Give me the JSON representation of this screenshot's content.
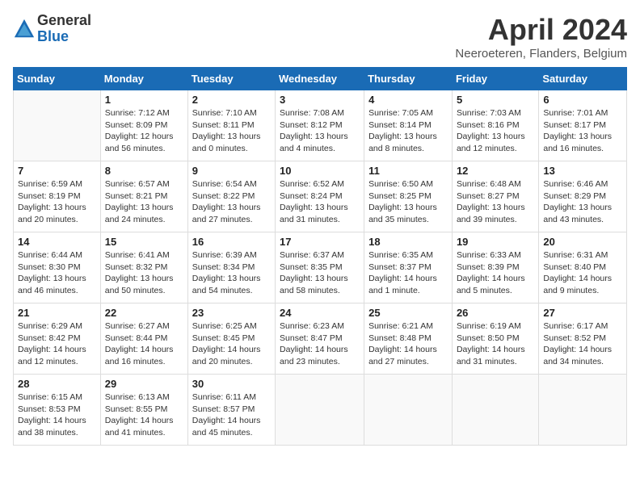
{
  "logo": {
    "general": "General",
    "blue": "Blue"
  },
  "title": "April 2024",
  "location": "Neeroeteren, Flanders, Belgium",
  "weekdays": [
    "Sunday",
    "Monday",
    "Tuesday",
    "Wednesday",
    "Thursday",
    "Friday",
    "Saturday"
  ],
  "weeks": [
    [
      {
        "day": "",
        "sunrise": "",
        "sunset": "",
        "daylight": ""
      },
      {
        "day": "1",
        "sunrise": "Sunrise: 7:12 AM",
        "sunset": "Sunset: 8:09 PM",
        "daylight": "Daylight: 12 hours and 56 minutes."
      },
      {
        "day": "2",
        "sunrise": "Sunrise: 7:10 AM",
        "sunset": "Sunset: 8:11 PM",
        "daylight": "Daylight: 13 hours and 0 minutes."
      },
      {
        "day": "3",
        "sunrise": "Sunrise: 7:08 AM",
        "sunset": "Sunset: 8:12 PM",
        "daylight": "Daylight: 13 hours and 4 minutes."
      },
      {
        "day": "4",
        "sunrise": "Sunrise: 7:05 AM",
        "sunset": "Sunset: 8:14 PM",
        "daylight": "Daylight: 13 hours and 8 minutes."
      },
      {
        "day": "5",
        "sunrise": "Sunrise: 7:03 AM",
        "sunset": "Sunset: 8:16 PM",
        "daylight": "Daylight: 13 hours and 12 minutes."
      },
      {
        "day": "6",
        "sunrise": "Sunrise: 7:01 AM",
        "sunset": "Sunset: 8:17 PM",
        "daylight": "Daylight: 13 hours and 16 minutes."
      }
    ],
    [
      {
        "day": "7",
        "sunrise": "Sunrise: 6:59 AM",
        "sunset": "Sunset: 8:19 PM",
        "daylight": "Daylight: 13 hours and 20 minutes."
      },
      {
        "day": "8",
        "sunrise": "Sunrise: 6:57 AM",
        "sunset": "Sunset: 8:21 PM",
        "daylight": "Daylight: 13 hours and 24 minutes."
      },
      {
        "day": "9",
        "sunrise": "Sunrise: 6:54 AM",
        "sunset": "Sunset: 8:22 PM",
        "daylight": "Daylight: 13 hours and 27 minutes."
      },
      {
        "day": "10",
        "sunrise": "Sunrise: 6:52 AM",
        "sunset": "Sunset: 8:24 PM",
        "daylight": "Daylight: 13 hours and 31 minutes."
      },
      {
        "day": "11",
        "sunrise": "Sunrise: 6:50 AM",
        "sunset": "Sunset: 8:25 PM",
        "daylight": "Daylight: 13 hours and 35 minutes."
      },
      {
        "day": "12",
        "sunrise": "Sunrise: 6:48 AM",
        "sunset": "Sunset: 8:27 PM",
        "daylight": "Daylight: 13 hours and 39 minutes."
      },
      {
        "day": "13",
        "sunrise": "Sunrise: 6:46 AM",
        "sunset": "Sunset: 8:29 PM",
        "daylight": "Daylight: 13 hours and 43 minutes."
      }
    ],
    [
      {
        "day": "14",
        "sunrise": "Sunrise: 6:44 AM",
        "sunset": "Sunset: 8:30 PM",
        "daylight": "Daylight: 13 hours and 46 minutes."
      },
      {
        "day": "15",
        "sunrise": "Sunrise: 6:41 AM",
        "sunset": "Sunset: 8:32 PM",
        "daylight": "Daylight: 13 hours and 50 minutes."
      },
      {
        "day": "16",
        "sunrise": "Sunrise: 6:39 AM",
        "sunset": "Sunset: 8:34 PM",
        "daylight": "Daylight: 13 hours and 54 minutes."
      },
      {
        "day": "17",
        "sunrise": "Sunrise: 6:37 AM",
        "sunset": "Sunset: 8:35 PM",
        "daylight": "Daylight: 13 hours and 58 minutes."
      },
      {
        "day": "18",
        "sunrise": "Sunrise: 6:35 AM",
        "sunset": "Sunset: 8:37 PM",
        "daylight": "Daylight: 14 hours and 1 minute."
      },
      {
        "day": "19",
        "sunrise": "Sunrise: 6:33 AM",
        "sunset": "Sunset: 8:39 PM",
        "daylight": "Daylight: 14 hours and 5 minutes."
      },
      {
        "day": "20",
        "sunrise": "Sunrise: 6:31 AM",
        "sunset": "Sunset: 8:40 PM",
        "daylight": "Daylight: 14 hours and 9 minutes."
      }
    ],
    [
      {
        "day": "21",
        "sunrise": "Sunrise: 6:29 AM",
        "sunset": "Sunset: 8:42 PM",
        "daylight": "Daylight: 14 hours and 12 minutes."
      },
      {
        "day": "22",
        "sunrise": "Sunrise: 6:27 AM",
        "sunset": "Sunset: 8:44 PM",
        "daylight": "Daylight: 14 hours and 16 minutes."
      },
      {
        "day": "23",
        "sunrise": "Sunrise: 6:25 AM",
        "sunset": "Sunset: 8:45 PM",
        "daylight": "Daylight: 14 hours and 20 minutes."
      },
      {
        "day": "24",
        "sunrise": "Sunrise: 6:23 AM",
        "sunset": "Sunset: 8:47 PM",
        "daylight": "Daylight: 14 hours and 23 minutes."
      },
      {
        "day": "25",
        "sunrise": "Sunrise: 6:21 AM",
        "sunset": "Sunset: 8:48 PM",
        "daylight": "Daylight: 14 hours and 27 minutes."
      },
      {
        "day": "26",
        "sunrise": "Sunrise: 6:19 AM",
        "sunset": "Sunset: 8:50 PM",
        "daylight": "Daylight: 14 hours and 31 minutes."
      },
      {
        "day": "27",
        "sunrise": "Sunrise: 6:17 AM",
        "sunset": "Sunset: 8:52 PM",
        "daylight": "Daylight: 14 hours and 34 minutes."
      }
    ],
    [
      {
        "day": "28",
        "sunrise": "Sunrise: 6:15 AM",
        "sunset": "Sunset: 8:53 PM",
        "daylight": "Daylight: 14 hours and 38 minutes."
      },
      {
        "day": "29",
        "sunrise": "Sunrise: 6:13 AM",
        "sunset": "Sunset: 8:55 PM",
        "daylight": "Daylight: 14 hours and 41 minutes."
      },
      {
        "day": "30",
        "sunrise": "Sunrise: 6:11 AM",
        "sunset": "Sunset: 8:57 PM",
        "daylight": "Daylight: 14 hours and 45 minutes."
      },
      {
        "day": "",
        "sunrise": "",
        "sunset": "",
        "daylight": ""
      },
      {
        "day": "",
        "sunrise": "",
        "sunset": "",
        "daylight": ""
      },
      {
        "day": "",
        "sunrise": "",
        "sunset": "",
        "daylight": ""
      },
      {
        "day": "",
        "sunrise": "",
        "sunset": "",
        "daylight": ""
      }
    ]
  ]
}
